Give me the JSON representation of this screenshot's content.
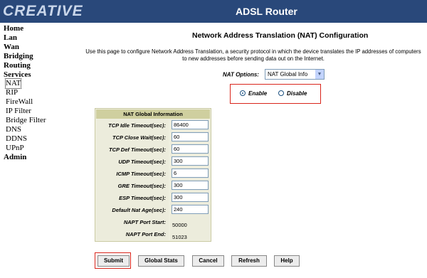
{
  "header": {
    "logo": "CREATIVE",
    "title": "ADSL Router"
  },
  "sidebar": [
    {
      "label": "Home",
      "level": "top"
    },
    {
      "label": "Lan",
      "level": "top"
    },
    {
      "label": "Wan",
      "level": "top"
    },
    {
      "label": "Bridging",
      "level": "top"
    },
    {
      "label": "Routing",
      "level": "top"
    },
    {
      "label": "Services",
      "level": "top"
    },
    {
      "label": "NAT",
      "level": "sub",
      "selected": true
    },
    {
      "label": "RIP",
      "level": "sub"
    },
    {
      "label": "FireWall",
      "level": "sub"
    },
    {
      "label": "IP Filter",
      "level": "sub"
    },
    {
      "label": "Bridge Filter",
      "level": "sub"
    },
    {
      "label": "DNS",
      "level": "sub"
    },
    {
      "label": "DDNS",
      "level": "sub"
    },
    {
      "label": "UPnP",
      "level": "sub"
    },
    {
      "label": "Admin",
      "level": "top"
    }
  ],
  "main": {
    "title": "Network Address Translation (NAT) Configuration",
    "description": "Use this page to configure Network Address Translation, a security protocol in which the device translates the IP addresses of computers to new addresses before sending data out on the Internet.",
    "nat_options_label": "NAT Options:",
    "nat_options_value": "NAT Global Info",
    "enable_label": "Enable",
    "disable_label": "Disable",
    "enabled": true,
    "table": {
      "header": "NAT Global Information",
      "rows": [
        {
          "label": "TCP Idle Timeout(sec):",
          "value": "86400",
          "editable": true
        },
        {
          "label": "TCP Close Wait(sec):",
          "value": "60",
          "editable": true
        },
        {
          "label": "TCP Def Timeout(sec):",
          "value": "60",
          "editable": true
        },
        {
          "label": "UDP Timeout(sec):",
          "value": "300",
          "editable": true
        },
        {
          "label": "ICMP Timeout(sec):",
          "value": "6",
          "editable": true
        },
        {
          "label": "GRE Timeout(sec):",
          "value": "300",
          "editable": true
        },
        {
          "label": "ESP Timeout(sec):",
          "value": "300",
          "editable": true
        },
        {
          "label": "Default Nat Age(sec):",
          "value": "240",
          "editable": true
        },
        {
          "label": "NAPT Port Start:",
          "value": "50000",
          "editable": false
        },
        {
          "label": "NAPT Port End:",
          "value": "51023",
          "editable": false
        }
      ]
    },
    "buttons": {
      "submit": "Submit",
      "global_stats": "Global Stats",
      "cancel": "Cancel",
      "refresh": "Refresh",
      "help": "Help"
    }
  }
}
